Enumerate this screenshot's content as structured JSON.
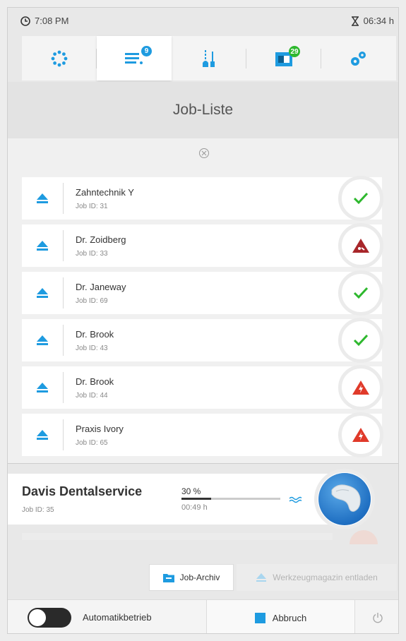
{
  "status": {
    "time": "7:08 PM",
    "duration": "06:34 h"
  },
  "tabs": [
    {
      "icon": "spinner-dots-icon"
    },
    {
      "icon": "job-list-icon",
      "badge": "9",
      "badge_color": "#1e9be0"
    },
    {
      "icon": "tool-holder-icon"
    },
    {
      "icon": "machine-icon",
      "badge": "29",
      "badge_color": "#2eb82e"
    },
    {
      "icon": "gears-icon"
    }
  ],
  "page": {
    "title": "Job-Liste"
  },
  "jobs": [
    {
      "name": "Zahntechnik Y",
      "id": "Job ID: 31",
      "status": "ok"
    },
    {
      "name": "Dr. Zoidberg",
      "id": "Job ID: 33",
      "status": "warning-dark"
    },
    {
      "name": "Dr. Janeway",
      "id": "Job ID: 69",
      "status": "ok"
    },
    {
      "name": "Dr. Brook",
      "id": "Job ID: 43",
      "status": "ok"
    },
    {
      "name": "Dr. Brook",
      "id": "Job ID: 44",
      "status": "error"
    },
    {
      "name": "Praxis Ivory",
      "id": "Job ID: 65",
      "status": "error"
    }
  ],
  "active_job": {
    "name": "Davis Dentalservice",
    "id": "Job ID: 35",
    "progress_label": "30 %",
    "progress": 0.3,
    "time": "00:49 h"
  },
  "buttons": {
    "archive": "Job-Archiv",
    "unload": "Werkzeugmagazin entladen",
    "auto": "Automatikbetrieb",
    "abort": "Abbruch"
  },
  "colors": {
    "accent": "#1e9be0",
    "ok": "#2eb82e",
    "error": "#e03a2a",
    "warning_dark": "#a8262a"
  }
}
